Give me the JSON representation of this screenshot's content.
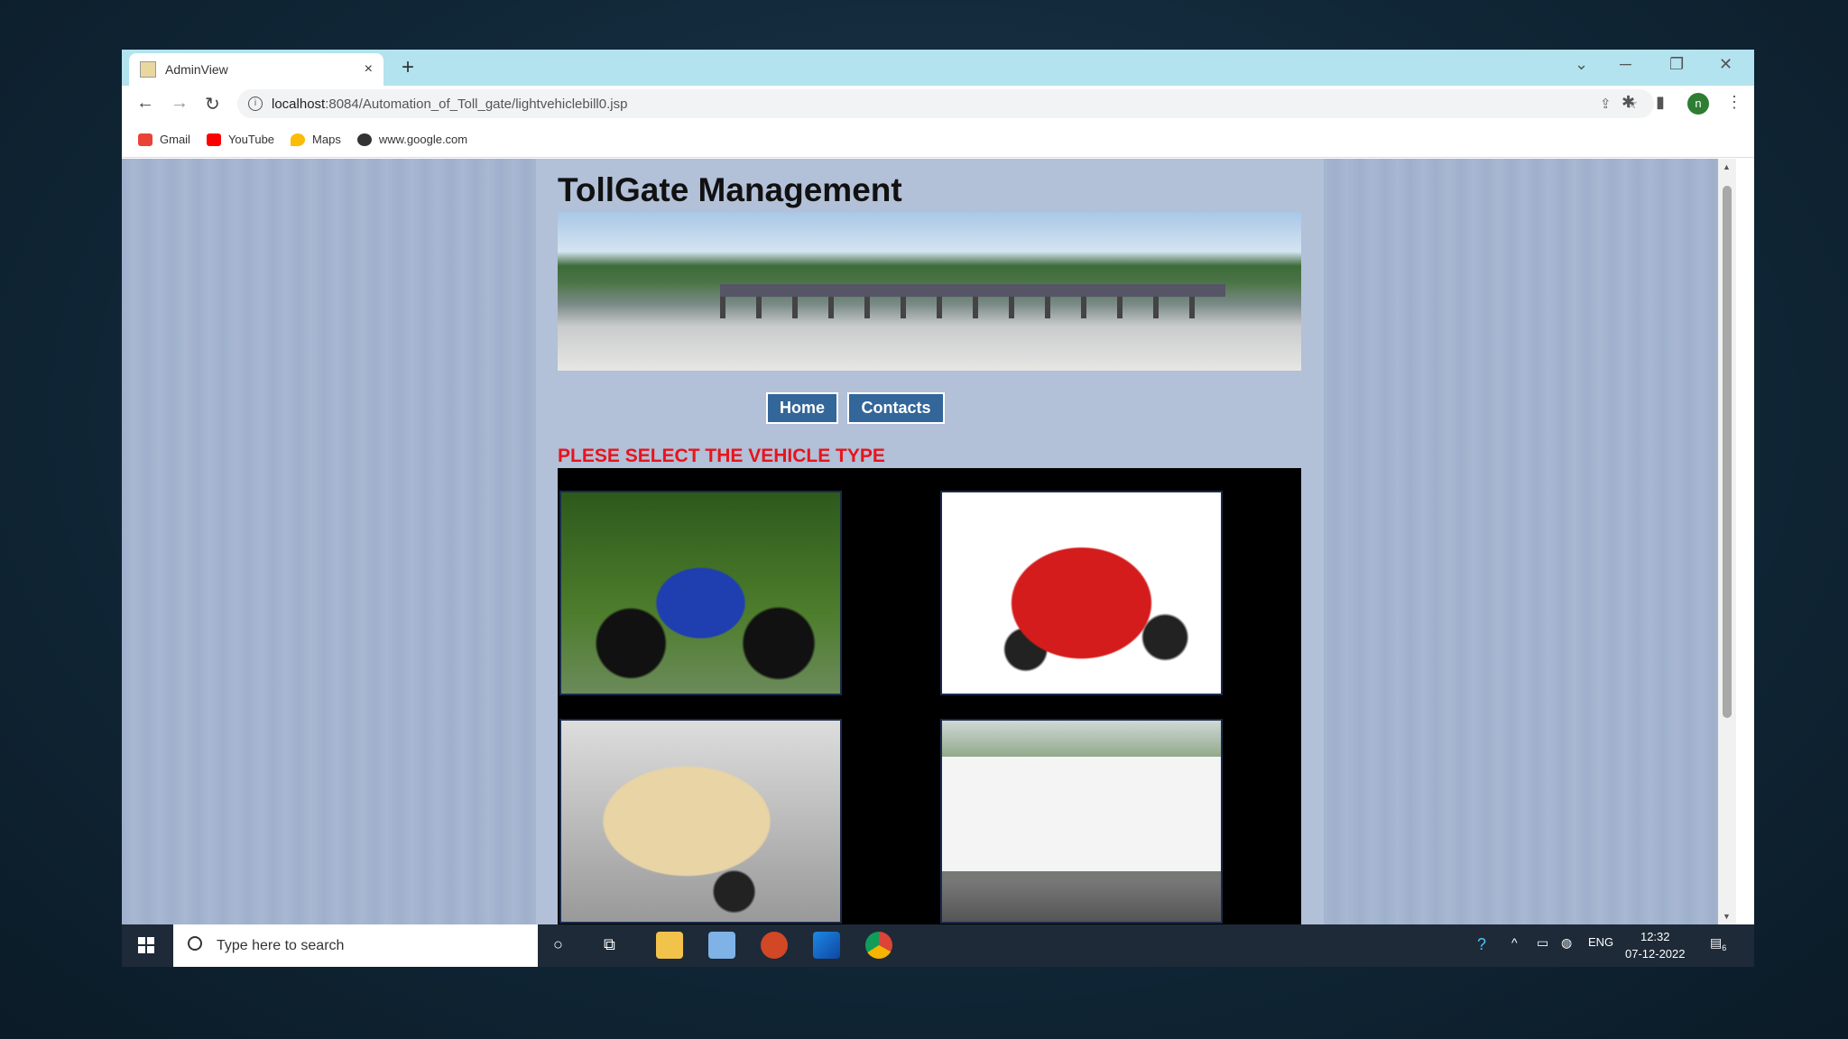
{
  "browser": {
    "tab_title": "AdminView",
    "tab_close": "×",
    "new_tab": "+",
    "url_host": "localhost",
    "url_rest": ":8084/Automation_of_Toll_gate/lightvehiclebill0.jsp",
    "bookmarks": [
      {
        "label": "Gmail",
        "icon": "gmail-icon",
        "color": "#ea4335"
      },
      {
        "label": "YouTube",
        "icon": "youtube-icon",
        "color": "#ff0000"
      },
      {
        "label": "Maps",
        "icon": "maps-icon",
        "color": "#fbbc04"
      },
      {
        "label": "www.google.com",
        "icon": "globe-icon",
        "color": "#333333"
      }
    ],
    "profile_initial": "n"
  },
  "page": {
    "title": "TollGate Management",
    "nav": {
      "home": "Home",
      "contacts": "Contacts"
    },
    "prompt": "PLESE SELECT THE VEHICLE TYPE",
    "vehicles": [
      "motorcycle",
      "car",
      "pickup-truck",
      "bus"
    ]
  },
  "taskbar": {
    "search_placeholder": "Type here to search",
    "language": "ENG",
    "time": "12:32",
    "date": "07-12-2022",
    "notifications": "6"
  }
}
